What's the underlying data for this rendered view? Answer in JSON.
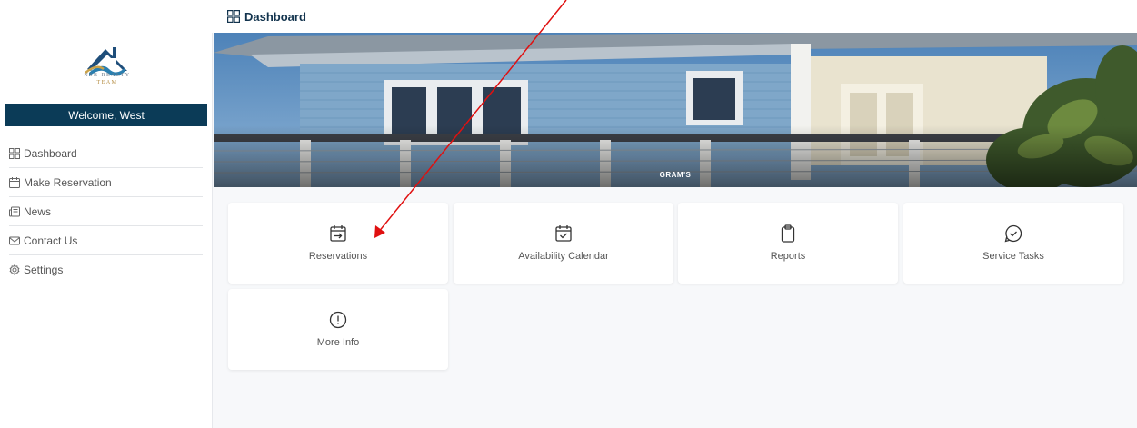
{
  "brand": {
    "name": "NSB REALTY",
    "subtitle": "TEAM"
  },
  "sidebar": {
    "welcome": "Welcome, West",
    "items": [
      {
        "label": "Dashboard",
        "icon": "dashboard-grid-icon"
      },
      {
        "label": "Make Reservation",
        "icon": "calendar-icon"
      },
      {
        "label": "News",
        "icon": "news-icon"
      },
      {
        "label": "Contact Us",
        "icon": "mail-icon"
      },
      {
        "label": "Settings",
        "icon": "gear-icon"
      }
    ]
  },
  "header": {
    "title": "Dashboard",
    "icon": "dashboard-grid-icon"
  },
  "banner": {
    "caption": "GRAM'S"
  },
  "tiles": [
    {
      "label": "Reservations",
      "icon": "calendar-arrow-icon"
    },
    {
      "label": "Availability Calendar",
      "icon": "calendar-check-icon"
    },
    {
      "label": "Reports",
      "icon": "clipboard-icon"
    },
    {
      "label": "Service Tasks",
      "icon": "check-circle-chat-icon"
    },
    {
      "label": "More Info",
      "icon": "info-exclamation-icon"
    }
  ],
  "colors": {
    "primary": "#0b3b57",
    "title": "#13344e",
    "background": "#f7f8fa",
    "annotation": "#e01010"
  }
}
